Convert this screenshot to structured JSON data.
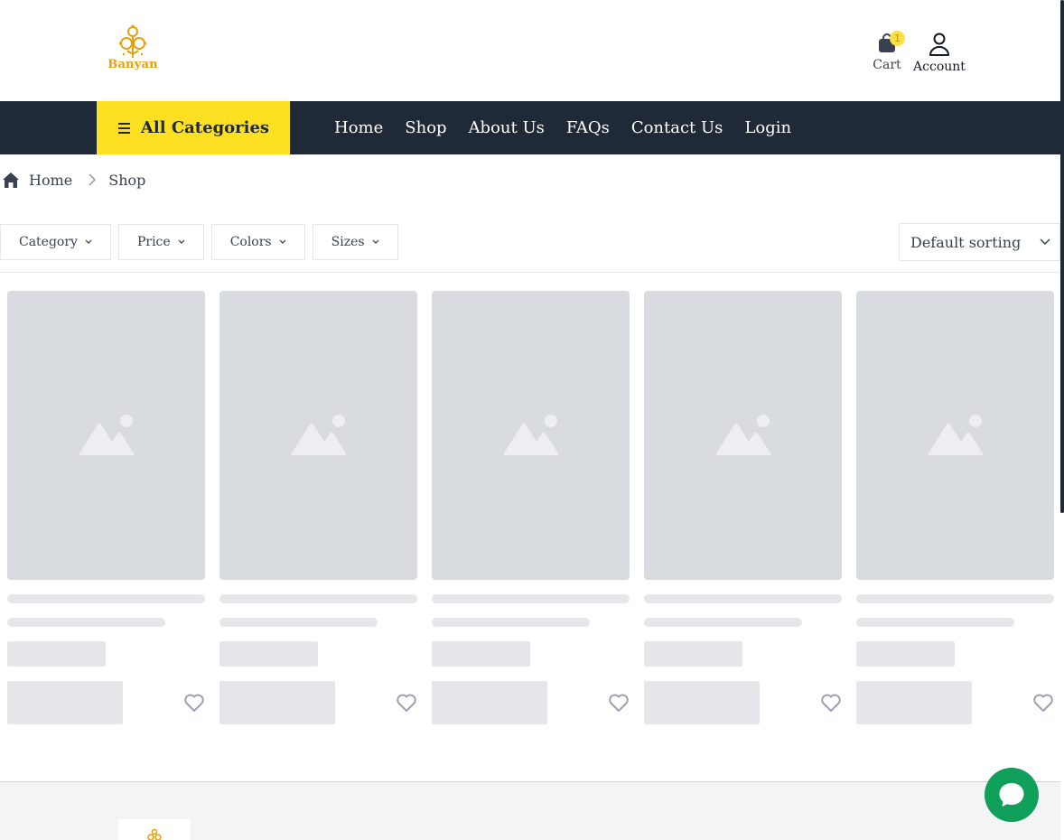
{
  "brand": {
    "name": "Banyan",
    "color": "#e9a10a"
  },
  "header": {
    "cart": {
      "label": "Cart",
      "count": "1"
    },
    "account": {
      "label": "Account"
    }
  },
  "nav": {
    "all_categories": "All Categories",
    "links": [
      "Home",
      "Shop",
      "About Us",
      "FAQs",
      "Contact Us",
      "Login"
    ]
  },
  "breadcrumb": {
    "home": "Home",
    "current": "Shop"
  },
  "filters": [
    "Category",
    "Price",
    "Colors",
    "Sizes"
  ],
  "sorting": {
    "selected": "Default sorting"
  },
  "products": {
    "loading": true,
    "placeholder_count": 5
  },
  "colors": {
    "accent": "#fde021",
    "nav_bg": "#1f2937",
    "chat": "#10a05c",
    "skeleton": "#d8dbe0"
  }
}
